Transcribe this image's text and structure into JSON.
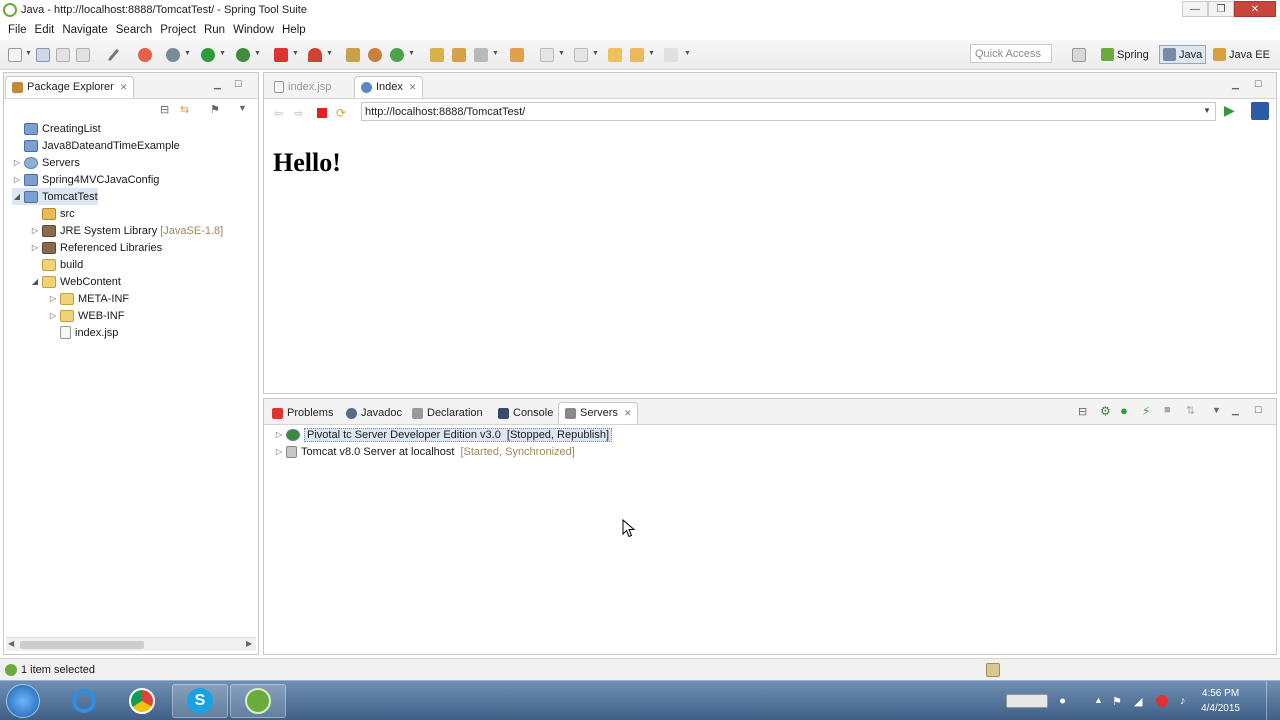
{
  "window": {
    "title": "Java - http://localhost:8888/TomcatTest/ - Spring Tool Suite",
    "minimize": "—",
    "maximize": "❐",
    "close": "✕"
  },
  "menu": [
    "File",
    "Edit",
    "Navigate",
    "Search",
    "Project",
    "Run",
    "Window",
    "Help"
  ],
  "toolbar": {
    "quick_access_placeholder": "Quick Access",
    "perspectives": [
      "Spring",
      "Java",
      "Java EE"
    ]
  },
  "package_explorer": {
    "title": "Package Explorer",
    "items": [
      {
        "label": "CreatingList",
        "extra": ""
      },
      {
        "label": "Java8DateandTimeExample",
        "extra": ""
      },
      {
        "label": "Servers",
        "extra": ""
      },
      {
        "label": "Spring4MVCJavaConfig",
        "extra": ""
      },
      {
        "label": "TomcatTest",
        "extra": ""
      },
      {
        "label": "src",
        "extra": ""
      },
      {
        "label": "JRE System Library",
        "extra": "[JavaSE-1.8]"
      },
      {
        "label": "Referenced Libraries",
        "extra": ""
      },
      {
        "label": "build",
        "extra": ""
      },
      {
        "label": "WebContent",
        "extra": ""
      },
      {
        "label": "META-INF",
        "extra": ""
      },
      {
        "label": "WEB-INF",
        "extra": ""
      },
      {
        "label": "index.jsp",
        "extra": ""
      }
    ]
  },
  "editor": {
    "tabs": [
      "index.jsp",
      "Index"
    ],
    "url": "http://localhost:8888/TomcatTest/",
    "page_heading": "Hello!"
  },
  "bottom_panel": {
    "tabs": [
      "Problems",
      "Javadoc",
      "Declaration",
      "Console",
      "Servers"
    ],
    "servers": [
      {
        "name": "Pivotal tc Server Developer Edition v3.0",
        "status": "[Stopped, Republish]"
      },
      {
        "name": "Tomcat v8.0 Server at localhost",
        "status": "[Started, Synchronized]"
      }
    ]
  },
  "status": {
    "text": "1 item selected"
  },
  "taskbar": {
    "time": "4:56 PM",
    "date": "4/4/2015"
  },
  "colors": {
    "accent": "#6aab3c",
    "selection": "#dde6f3",
    "taskbar": "#4d6d93",
    "server_status": "#a0885a"
  }
}
